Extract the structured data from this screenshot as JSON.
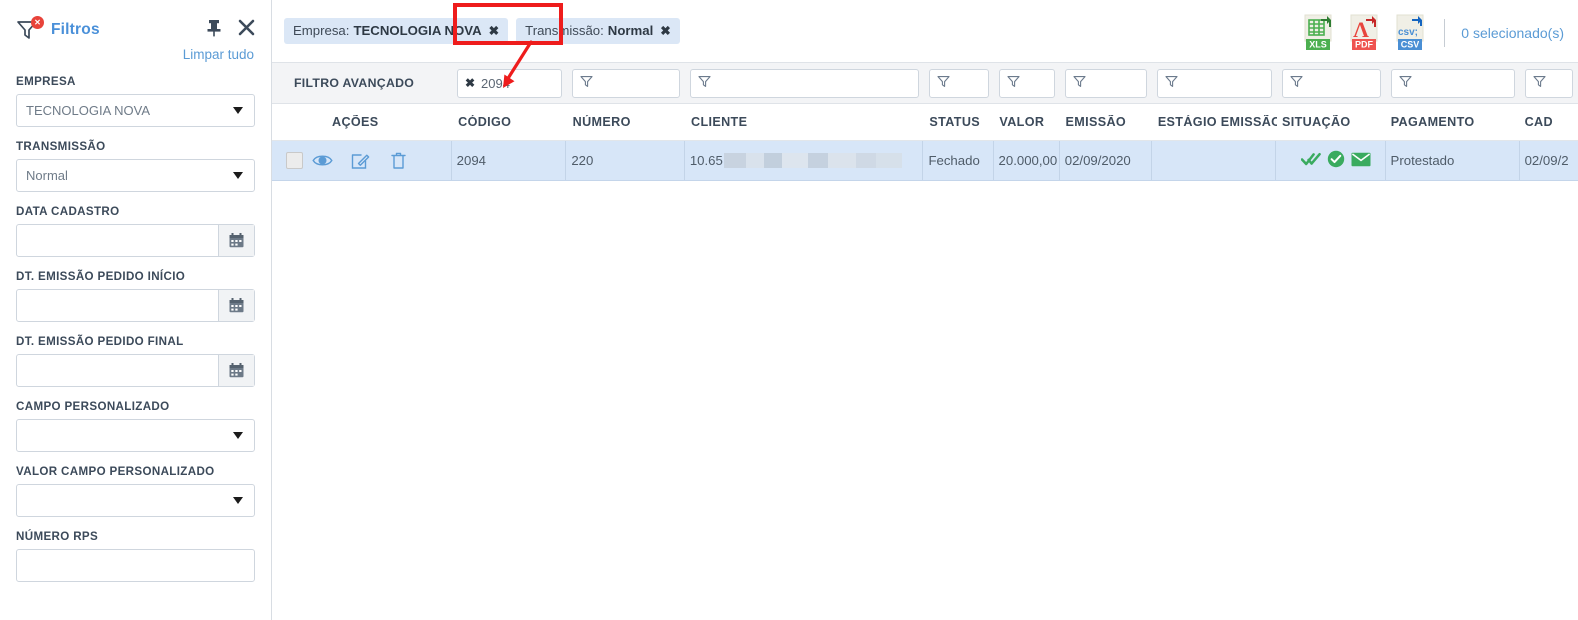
{
  "sidebar": {
    "title": "Filtros",
    "filter_badge": "✕",
    "pin_icon": "pin-icon",
    "close_icon": "close-icon",
    "clear_all": "Limpar tudo",
    "fields": [
      {
        "label": "EMPRESA",
        "type": "select",
        "value": "TECNOLOGIA NOVA"
      },
      {
        "label": "TRANSMISSÃO",
        "type": "select",
        "value": "Normal"
      },
      {
        "label": "DATA CADASTRO",
        "type": "date",
        "value": ""
      },
      {
        "label": "DT. EMISSÃO PEDIDO INÍCIO",
        "type": "date",
        "value": ""
      },
      {
        "label": "DT. EMISSÃO PEDIDO FINAL",
        "type": "date",
        "value": ""
      },
      {
        "label": "CAMPO PERSONALIZADO",
        "type": "select",
        "value": ""
      },
      {
        "label": "VALOR CAMPO PERSONALIZADO",
        "type": "select",
        "value": ""
      },
      {
        "label": "NÚMERO RPS",
        "type": "text",
        "value": ""
      }
    ]
  },
  "chips": [
    {
      "label": "Empresa:",
      "value": "TECNOLOGIA NOVA",
      "remove": "✖"
    },
    {
      "label": "Transmissão:",
      "value": "Normal",
      "remove": "✖"
    }
  ],
  "export": {
    "xls_label": "XLS",
    "pdf_label": "PDF",
    "csv_label": "CSV",
    "csv_glyph": "csv;",
    "selected_text": "0 selecionado(s)"
  },
  "table": {
    "advanced_filter_label": "FILTRO AVANÇADO",
    "columns": [
      {
        "key": "acoes",
        "header": "AÇÕES",
        "filter": false
      },
      {
        "key": "codigo",
        "header": "CÓDIGO",
        "filter": true,
        "filter_value": "2094",
        "filter_clear": "✖"
      },
      {
        "key": "numero",
        "header": "NÚMERO",
        "filter": true,
        "filter_value": ""
      },
      {
        "key": "cliente",
        "header": "CLIENTE",
        "filter": true,
        "filter_value": ""
      },
      {
        "key": "status",
        "header": "STATUS",
        "filter": true,
        "filter_value": ""
      },
      {
        "key": "valor",
        "header": "VALOR",
        "filter": true,
        "filter_value": ""
      },
      {
        "key": "emissao",
        "header": "EMISSÃO",
        "filter": true,
        "filter_value": ""
      },
      {
        "key": "estagio",
        "header": "ESTÁGIO EMISSÃO",
        "filter": true,
        "filter_value": ""
      },
      {
        "key": "situacao",
        "header": "SITUAÇÃO",
        "filter": true,
        "filter_value": ""
      },
      {
        "key": "pagamento",
        "header": "PAGAMENTO",
        "filter": true,
        "filter_value": ""
      },
      {
        "key": "cadastro",
        "header": "CAD",
        "filter": true,
        "filter_value": ""
      }
    ],
    "rows": [
      {
        "selected": false,
        "codigo": "2094",
        "numero": "220",
        "cliente": "10.65",
        "cliente_redacted": true,
        "status": "Fechado",
        "valor": "20.000,00",
        "emissao": "02/09/2020",
        "estagio": "",
        "situacao_icons": [
          "double-check-icon",
          "circle-check-icon",
          "envelope-icon"
        ],
        "pagamento": "Protestado",
        "cadastro": "02/09/2"
      }
    ]
  },
  "colors": {
    "accent_blue": "#5b9bd5",
    "row_selected": "#d7e6f8",
    "status_green": "#3aab5f",
    "annotation_red": "#ee1c1c",
    "header_text": "#3c4a5a"
  }
}
